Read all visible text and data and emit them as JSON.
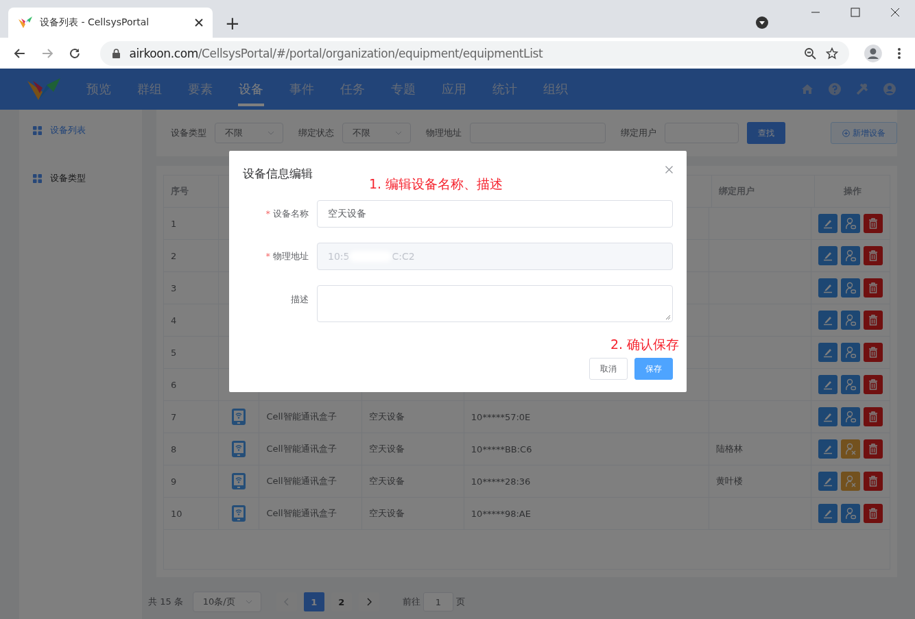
{
  "browser": {
    "tab_title": "设备列表 - CellsysPortal",
    "new_tab": "+",
    "url_host": "airkoon.com",
    "url_path": "/CellsysPortal/#/portal/organization/equipment/equipmentList"
  },
  "nav": {
    "items": [
      {
        "label": "预览",
        "selected": false
      },
      {
        "label": "群组",
        "selected": false
      },
      {
        "label": "要素",
        "selected": false
      },
      {
        "label": "设备",
        "selected": true
      },
      {
        "label": "事件",
        "selected": false
      },
      {
        "label": "任务",
        "selected": false
      },
      {
        "label": "专题",
        "selected": false
      },
      {
        "label": "应用",
        "selected": false
      },
      {
        "label": "统计",
        "selected": false
      },
      {
        "label": "组织",
        "selected": false
      }
    ]
  },
  "sidebar": {
    "items": [
      {
        "label": "设备列表",
        "selected": true
      },
      {
        "label": "设备类型",
        "selected": false
      }
    ]
  },
  "filters": {
    "type_label": "设备类型",
    "type_value": "不限",
    "bind_label": "绑定状态",
    "bind_value": "不限",
    "address_label": "物理地址",
    "user_label": "绑定用户",
    "search_button": "查找",
    "add_button": "新增设备"
  },
  "table": {
    "heading_index": "序号",
    "heading_user": "绑定用户",
    "heading_actions": "操作",
    "rows": [
      {
        "index": "1",
        "bound": false
      },
      {
        "index": "2",
        "bound": false
      },
      {
        "index": "3",
        "bound": false
      },
      {
        "index": "4",
        "bound": false
      },
      {
        "index": "5",
        "bound": false
      },
      {
        "index": "6",
        "bound": false
      },
      {
        "index": "7",
        "name": "Cell智能通讯盒子",
        "type": "空天设备",
        "address": "10*****57:0E",
        "bound": false
      },
      {
        "index": "8",
        "name": "Cell智能通讯盒子",
        "type": "空天设备",
        "address": "10*****BB:C6",
        "user": "陆格林",
        "bound": true
      },
      {
        "index": "9",
        "name": "Cell智能通讯盒子",
        "type": "空天设备",
        "address": "10*****28:36",
        "user": "黄叶楼",
        "bound": true
      },
      {
        "index": "10",
        "name": "Cell智能通讯盒子",
        "type": "空天设备",
        "address": "10*****98:AE",
        "bound": false
      }
    ]
  },
  "pagination": {
    "total": "共 15 条",
    "page_size": "10条/页",
    "pages": [
      {
        "label": "1",
        "selected": true
      },
      {
        "label": "2",
        "selected": false
      }
    ],
    "goto_label": "前往",
    "goto_value": "1",
    "goto_unit": "页"
  },
  "dialog": {
    "title": "设备信息编辑",
    "fields": [
      {
        "kind": "input",
        "label": "设备名称",
        "required": true,
        "value": "空天设备",
        "disabled": false
      },
      {
        "kind": "redacted",
        "label": "物理地址",
        "required": true,
        "value_start": "10:5",
        "value_end": "C:C2",
        "disabled": true
      },
      {
        "kind": "textarea",
        "label": "描述",
        "required": false
      }
    ],
    "required_mark": "*",
    "cancel": "取消",
    "save": "保存",
    "notes": [
      "1. 编辑设备名称、描述",
      "2. 确认保存"
    ]
  }
}
